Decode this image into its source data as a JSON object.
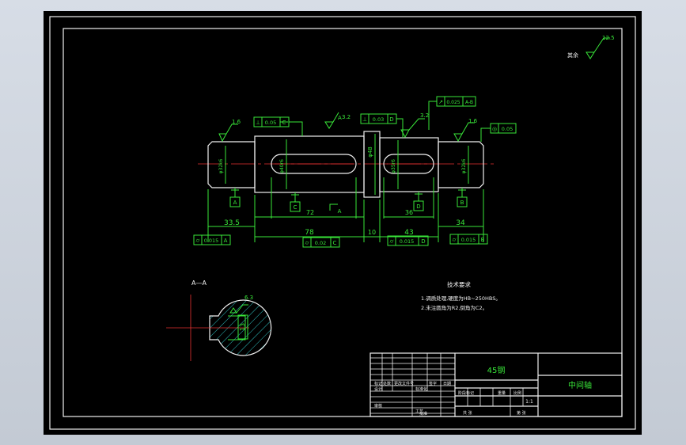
{
  "drawing": {
    "overall_roughness": "12.5",
    "overall_roughness_label": "其余",
    "section_label": "A—A",
    "section_roughness": "6.3",
    "section_dim": "13",
    "tech_title": "技术要求",
    "tech_lines": [
      "1.调质处理,硬度为HB~250HBS。",
      "2.未注圆角为R2,倒角为C2。"
    ],
    "datums": [
      "A",
      "B",
      "C",
      "D"
    ],
    "datum_a_view": "A",
    "diameter_labels": [
      "φ32k6",
      "φ40r6",
      "φ48",
      "φ35r6",
      "φ32k6"
    ],
    "roughness_values": [
      "1.6",
      "3.2",
      "3.2",
      "1.6"
    ],
    "gdt": [
      {
        "sym": "⊥",
        "tol": "0.05",
        "ref": "C"
      },
      {
        "sym": "⊥",
        "tol": "0.03",
        "ref": "D"
      },
      {
        "sym": "↗",
        "tol": "0.025",
        "ref": "A-B"
      },
      {
        "sym": "◎",
        "tol": "0.05",
        "ref": ""
      },
      {
        "sym": "⌭",
        "tol": "0.015",
        "ref": "A"
      },
      {
        "sym": "⌭",
        "tol": "0.02",
        "ref": "C"
      },
      {
        "sym": "⌭",
        "tol": "0.015",
        "ref": "D"
      },
      {
        "sym": "⌭",
        "tol": "0.015",
        "ref": "B"
      }
    ],
    "dims": {
      "d335": "33.5",
      "d72": "72",
      "d36": "36",
      "d34": "34",
      "d78": "78",
      "d10": "10",
      "d43": "43"
    }
  },
  "title_block": {
    "material": "45钢",
    "part_name": "中间轴",
    "scale": "1:1",
    "row_labels": [
      "标记",
      "处数",
      "更改文件号",
      "签字",
      "日期"
    ],
    "design": "设计",
    "review": "审核",
    "process": "工艺",
    "approve": "批准",
    "stage_label": "阶段标记",
    "weight_label": "重量",
    "scale_label": "比例",
    "sheet_label": "共 张",
    "sheet_no": "第 张",
    "std": "标准化"
  }
}
